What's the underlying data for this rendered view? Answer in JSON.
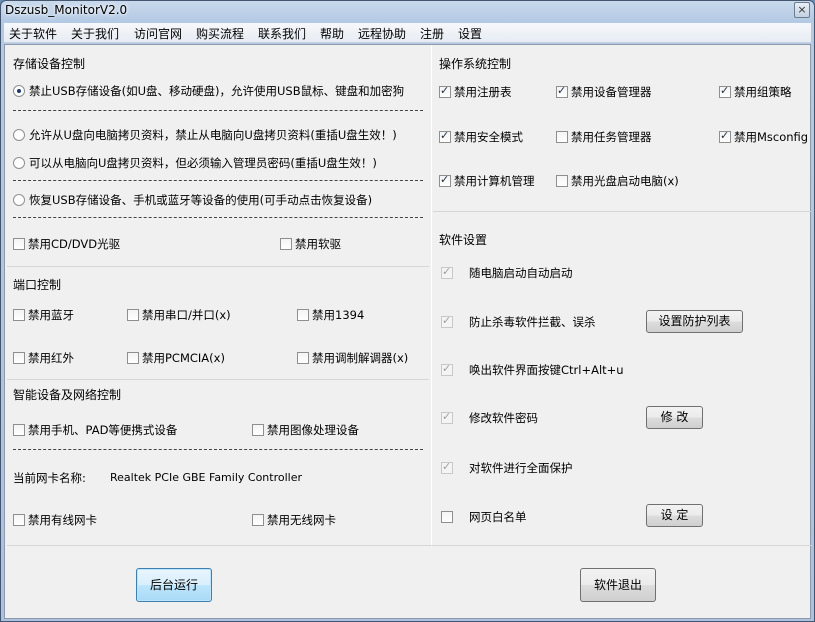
{
  "window": {
    "title": "Dszusb_MonitorV2.0",
    "close_symbol": "×"
  },
  "menu": [
    "关于软件",
    "关于我们",
    "访问官网",
    "购买流程",
    "联系我们",
    "帮助",
    "远程协助",
    "注册",
    "设置"
  ],
  "storage": {
    "title": "存储设备控制",
    "radio1": "禁止USB存储设备(如U盘、移动硬盘)，允许使用USB鼠标、键盘和加密狗",
    "radio2": "允许从U盘向电脑拷贝资料，禁止从电脑向U盘拷贝资料(重插U盘生效！)",
    "radio3": "可以从电脑向U盘拷贝资料，但必须输入管理员密码(重插U盘生效！)",
    "radio4": "恢复USB存储设备、手机或蓝牙等设备的使用(可手动点击恢复设备)",
    "cd": "禁用CD/DVD光驱",
    "floppy": "禁用软驱"
  },
  "port": {
    "title": "端口控制",
    "bluetooth": "禁用蓝牙",
    "serial": "禁用串口/并口(x)",
    "ieee1394": "禁用1394",
    "infrared": "禁用红外",
    "pcmcia": "禁用PCMCIA(x)",
    "modem": "禁用调制解调器(x)"
  },
  "smart": {
    "title": "智能设备及网络控制",
    "phone": "禁用手机、PAD等便携式设备",
    "imaging": "禁用图像处理设备",
    "nic_label": "当前网卡名称:",
    "nic_value": "Realtek PCIe GBE Family Controller",
    "wired": "禁用有线网卡",
    "wireless": "禁用无线网卡"
  },
  "os": {
    "title": "操作系统控制",
    "registry": "禁用注册表",
    "devmgr": "禁用设备管理器",
    "gpedit": "禁用组策略",
    "safemode": "禁用安全模式",
    "taskmgr": "禁用任务管理器",
    "msconfig": "禁用Msconfig",
    "compmgmt": "禁用计算机管理",
    "cdboot": "禁用光盘启动电脑(x)"
  },
  "software": {
    "title": "软件设置",
    "autostart": "随电脑启动自动启动",
    "antivirus": "防止杀毒软件拦截、误杀",
    "antivirus_btn": "设置防护列表",
    "hotkey": "唤出软件界面按键Ctrl+Alt+u",
    "password": "修改软件密码",
    "password_btn": "修 改",
    "protect": "对软件进行全面保护",
    "whitelist": "网页白名单",
    "whitelist_btn": "设 定"
  },
  "footer": {
    "run_bg": "后台运行",
    "exit": "软件退出"
  }
}
